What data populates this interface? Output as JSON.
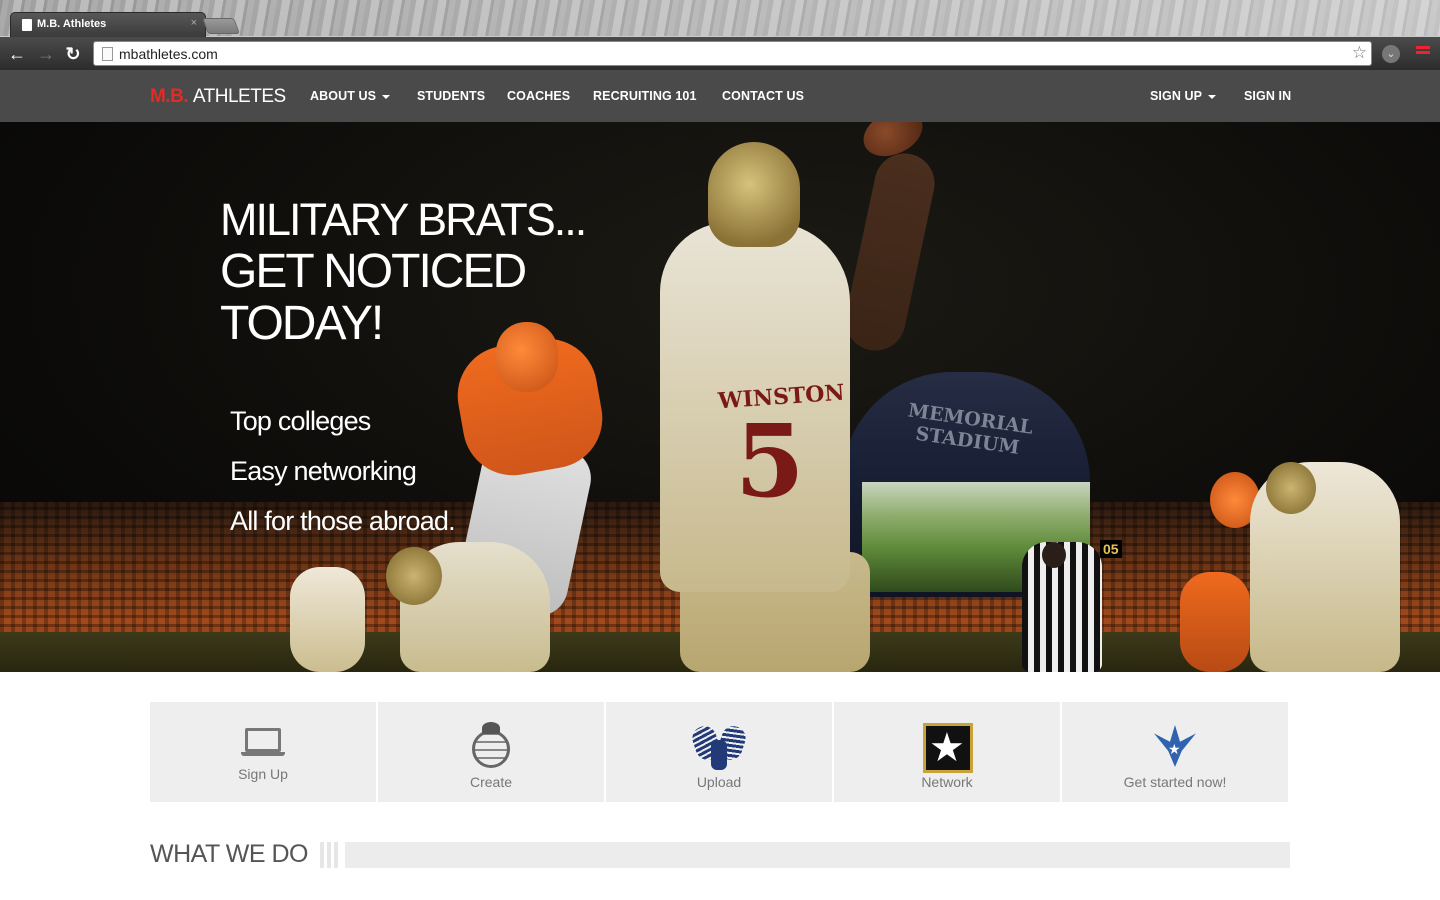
{
  "browser": {
    "tab_title": "M.B. Athletes",
    "tab_close": "×",
    "back": "←",
    "forward": "→",
    "reload": "↻",
    "url": "mbathletes.com",
    "star": "☆",
    "ext": "⌄"
  },
  "navbar": {
    "brand_mb": "M.B.",
    "brand_rest": "ATHLETES",
    "items": [
      {
        "label": "ABOUT US",
        "dropdown": true
      },
      {
        "label": "STUDENTS",
        "dropdown": false
      },
      {
        "label": "COACHES",
        "dropdown": false
      },
      {
        "label": "RECRUITING 101",
        "dropdown": false
      },
      {
        "label": "CONTACT US",
        "dropdown": false
      }
    ],
    "sign_up": "SIGN UP",
    "sign_in": "SIGN IN",
    "brand_color": "#e12b24"
  },
  "hero": {
    "line1": "MILITARY BRATS...",
    "line2": "GET NOTICED",
    "line3": "TODAY!",
    "taglines": [
      "Top colleges",
      "Easy networking",
      "All for those abroad."
    ],
    "jersey_name": "WINSTON",
    "jersey_number": "5",
    "stadium_sign": "MEMORIAL STADIUM",
    "score_left": "05",
    "score_right": "05"
  },
  "cards": [
    {
      "label": "Sign Up",
      "icon": "laptop-icon"
    },
    {
      "label": "Create",
      "icon": "marine-emblem-icon"
    },
    {
      "label": "Upload",
      "icon": "navy-eagle-icon"
    },
    {
      "label": "Network",
      "icon": "army-star-icon"
    },
    {
      "label": "Get started now!",
      "icon": "air-force-icon"
    }
  ],
  "section": {
    "title": "WHAT WE DO"
  }
}
